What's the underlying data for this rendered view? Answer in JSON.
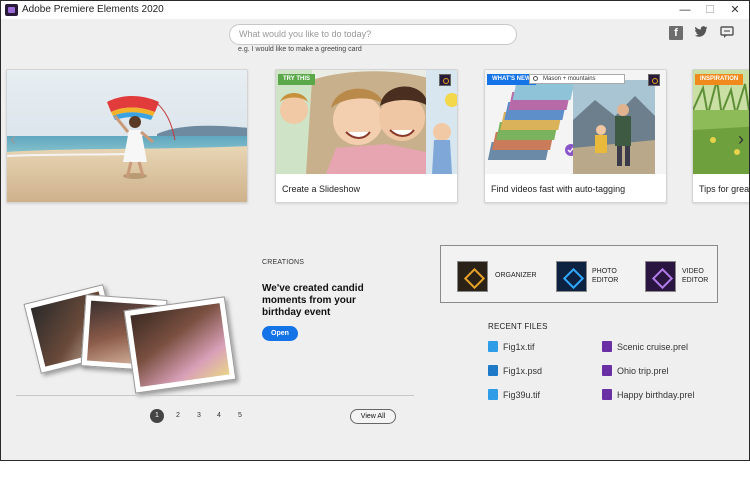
{
  "window": {
    "title": "Adobe Premiere Elements 2020",
    "controls": {
      "minimize": "—",
      "maximize": "☐",
      "close": "✕"
    }
  },
  "search": {
    "placeholder": "What would you like to do today?",
    "hint": "e.g. I would like to make a greeting card"
  },
  "social": {
    "facebook": "f",
    "twitter": "🐦",
    "chat": "💬"
  },
  "carousel": {
    "cards": [
      {
        "caption": "",
        "tag": ""
      },
      {
        "caption": "Create a Slideshow",
        "tag": "TRY THIS"
      },
      {
        "caption": "Find videos fast with auto-tagging",
        "tag": "WHAT'S NEW",
        "search_chip": "Mason + mountains"
      },
      {
        "caption": "Tips for grea",
        "tag": "INSPIRATION"
      }
    ],
    "prev_arrow": "‹",
    "next_arrow": "›"
  },
  "creations": {
    "label": "CREATIONS",
    "text": "We've created candid moments from your birthday event",
    "open_label": "Open",
    "pages": [
      "1",
      "2",
      "3",
      "4",
      "5"
    ],
    "active_page": "1",
    "view_all_label": "View All"
  },
  "launcher": {
    "organizer": "ORGANIZER",
    "photo_editor": "PHOTO EDITOR",
    "video_editor": "VIDEO EDITOR"
  },
  "recent_files": {
    "title": "RECENT FILES",
    "left": [
      {
        "name": "Fig1x.tif",
        "icon": "tif-file-icon"
      },
      {
        "name": "Fig1x.psd",
        "icon": "psd-file-icon"
      },
      {
        "name": "Fig39u.tif",
        "icon": "tif-file-icon"
      }
    ],
    "right": [
      {
        "name": "Scenic cruise.prel",
        "icon": "prel-file-icon"
      },
      {
        "name": "Ohio trip.prel",
        "icon": "prel-file-icon"
      },
      {
        "name": "Happy birthday.prel",
        "icon": "prel-file-icon"
      }
    ]
  },
  "colors": {
    "accent": "#1473e6",
    "try_this": "#5aa84a",
    "whats_new": "#1473e6",
    "inspiration": "#f08a1c"
  }
}
